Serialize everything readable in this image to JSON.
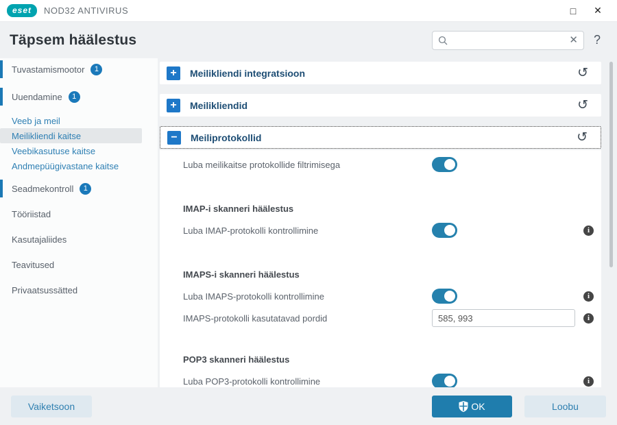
{
  "titlebar": {
    "logo": "eset",
    "app_name": "NOD32 ANTIVIRUS",
    "maximize_icon": "□",
    "close_icon": "✕"
  },
  "header": {
    "title": "Täpsem häälestus",
    "search": {
      "value": "",
      "placeholder": "",
      "clear_icon": "✕"
    },
    "help_icon": "?"
  },
  "sidebar": {
    "items": [
      {
        "label": "Tuvastamismootor",
        "badge": "1"
      },
      {
        "label": "Uuendamine",
        "badge": "1"
      },
      {
        "label": "Veeb ja meil"
      },
      {
        "label": "Meilikliendi kaitse",
        "selected": true
      },
      {
        "label": "Veebikasutuse kaitse"
      },
      {
        "label": "Andmepüügivastane kaitse"
      },
      {
        "label": "Seadmekontroll",
        "badge": "1"
      },
      {
        "label": "Tööriistad"
      },
      {
        "label": "Kasutajaliides"
      },
      {
        "label": "Teavitused"
      },
      {
        "label": "Privaatsussätted"
      }
    ]
  },
  "main": {
    "expand_icon": "+",
    "collapse_icon": "−",
    "revert_icon": "↺",
    "info_icon": "i",
    "sections": [
      {
        "title": "Meilikliendi integratsioon",
        "state": "collapsed"
      },
      {
        "title": "Meilikliendid",
        "state": "collapsed"
      },
      {
        "title": "Meiliprotokollid",
        "state": "expanded"
      }
    ],
    "rows": [
      {
        "type": "toggle",
        "label": "Luba meilikaitse protokollide filtrimisega",
        "value": "on"
      },
      {
        "type": "heading",
        "label": "IMAP-i skanneri häälestus"
      },
      {
        "type": "toggle",
        "label": "Luba IMAP-protokolli kontrollimine",
        "value": "on",
        "info": true
      },
      {
        "type": "heading",
        "label": "IMAPS-i skanneri häälestus"
      },
      {
        "type": "toggle",
        "label": "Luba IMAPS-protokolli kontrollimine",
        "value": "on",
        "info": true
      },
      {
        "type": "input",
        "label": "IMAPS-protokolli kasutatavad pordid",
        "value": "585, 993",
        "info": true
      },
      {
        "type": "heading",
        "label": "POP3 skanneri häälestus"
      },
      {
        "type": "toggle",
        "label": "Luba POP3-protokolli kontrollimine",
        "value": "on",
        "info": true
      }
    ]
  },
  "footer": {
    "defaults_label": "Vaiketsoon",
    "ok_label": "OK",
    "cancel_label": "Loobu"
  },
  "colors": {
    "accent_blue": "#1f7dad",
    "icon_blue": "#1e78c8",
    "eset_teal": "#00a3af",
    "link_blue": "#2e7fb3",
    "badge_blue": "#1a79ba",
    "section_title": "#1d4d74"
  }
}
